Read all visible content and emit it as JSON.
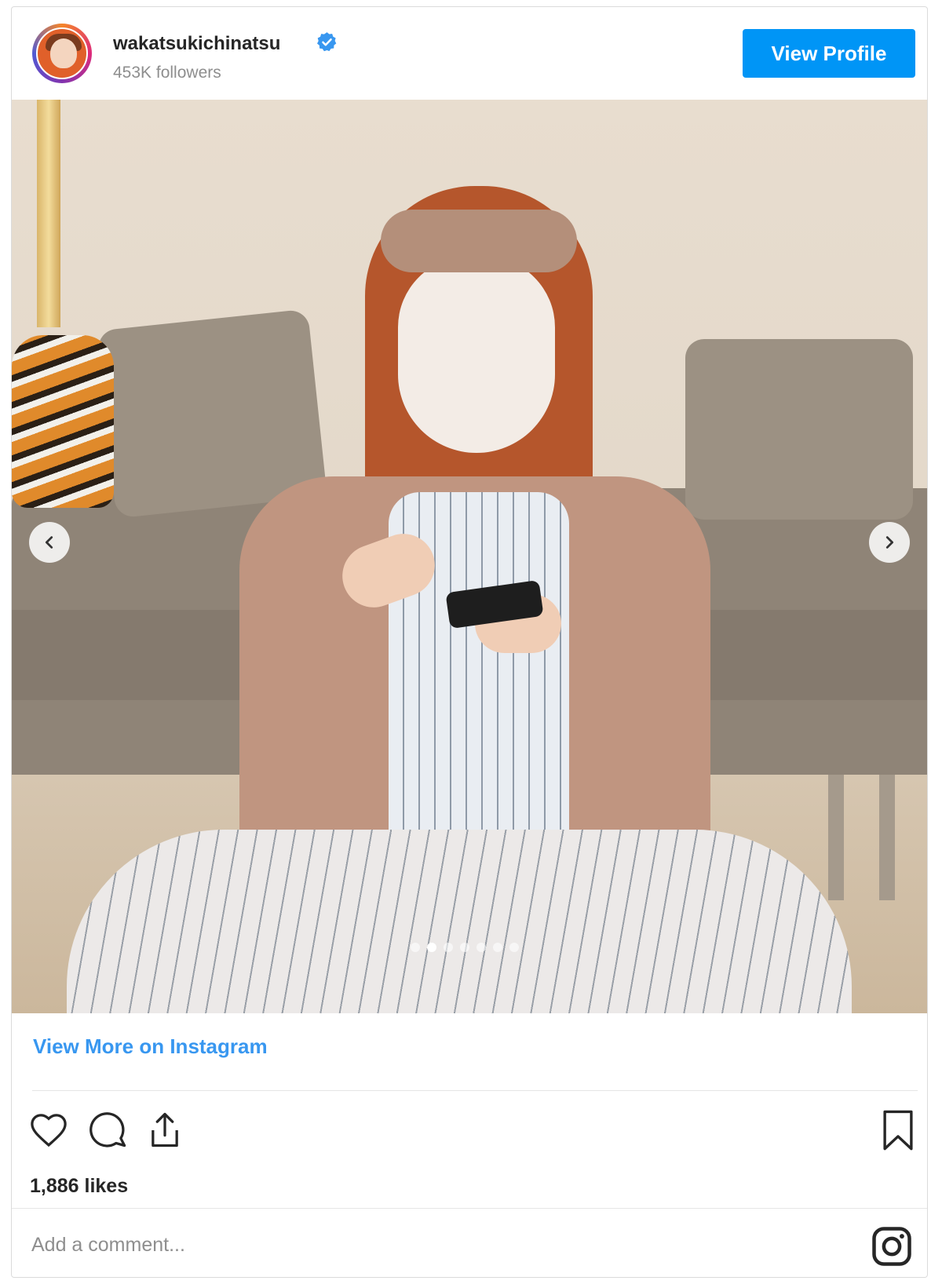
{
  "header": {
    "username": "wakatsukichinatsu",
    "followers": "453K followers",
    "view_profile_label": "View Profile",
    "verified_icon": "verified-badge-icon"
  },
  "carousel": {
    "slide_count": 7,
    "active_slide": 2,
    "prev_icon": "chevron-left-icon",
    "next_icon": "chevron-right-icon"
  },
  "footer": {
    "view_more_label": "View More on Instagram",
    "likes": "1,886 likes",
    "comment_placeholder": "Add a comment..."
  },
  "icons": {
    "like": "heart-icon",
    "comment": "comment-icon",
    "share": "share-icon",
    "save": "bookmark-icon",
    "brand": "instagram-icon"
  },
  "colors": {
    "accent": "#0095f6",
    "link": "#3897f0",
    "muted": "#8e8e8e",
    "text": "#262626"
  }
}
